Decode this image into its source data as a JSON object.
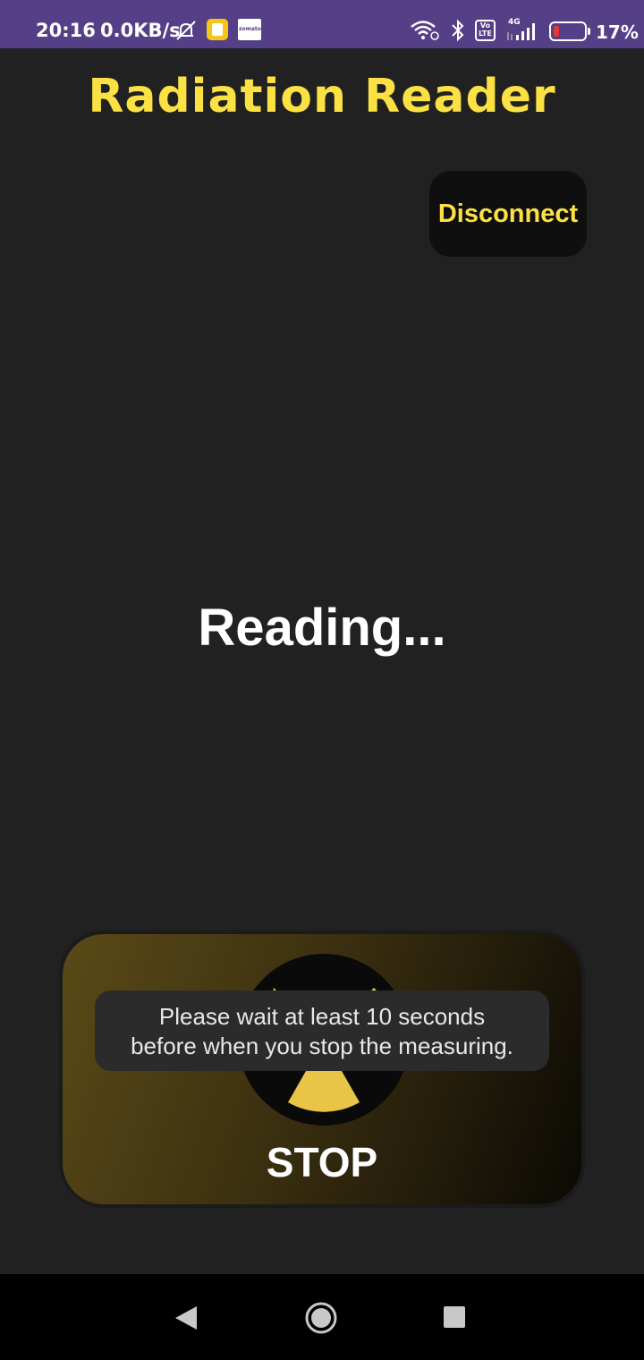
{
  "status_bar": {
    "time": "20:16",
    "speed": "0.0KB/s",
    "zomato_label": "zomato",
    "volte_label": "Vo LTE",
    "network_type": "4G",
    "battery_level": 0.17,
    "battery_percent": "17%",
    "bg_color": "#553f86",
    "icons": [
      "notifications-off-icon",
      "app-notification-icon",
      "zomato-icon",
      "wifi-icon",
      "bluetooth-icon",
      "volte-icon",
      "signal-icon",
      "battery-icon"
    ]
  },
  "app": {
    "title": "Radiation Reader",
    "disconnect_label": "Disconnect",
    "status_text": "Reading...",
    "stop_label": "STOP",
    "toast_line1": "Please wait at least 10 seconds",
    "toast_line2": "before when you stop the measuring.",
    "accent_color": "#fbe143",
    "background_color": "#212121"
  },
  "nav_bar": {
    "icons": [
      "back-icon",
      "home-icon",
      "recents-icon"
    ]
  }
}
